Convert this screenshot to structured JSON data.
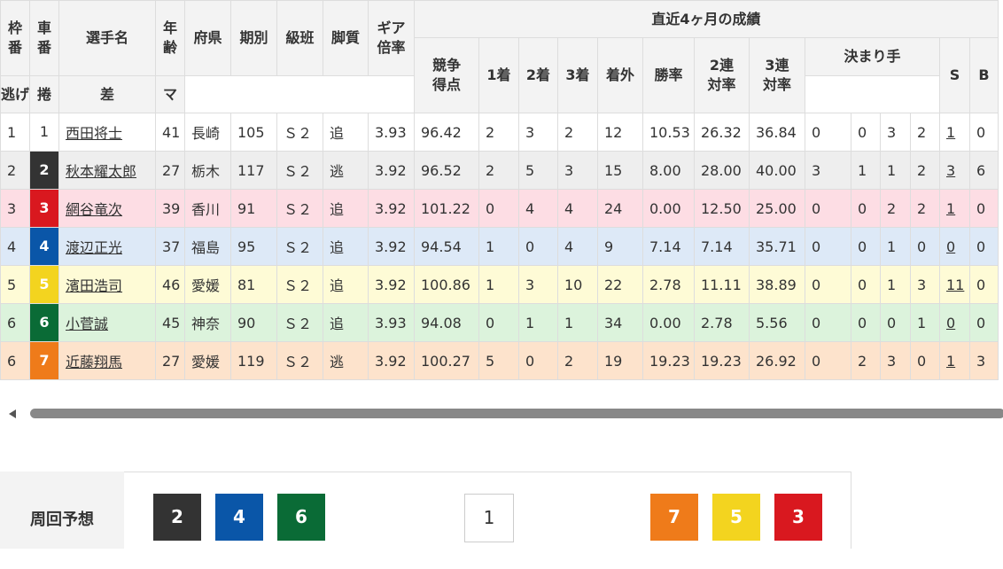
{
  "headers": {
    "waku": "枠\n番",
    "car": "車\n番",
    "name": "選手名",
    "age": "年\n齢",
    "pref": "府県",
    "term": "期別",
    "class": "級班",
    "leg": "脚質",
    "gear": "ギア\n倍率",
    "recent": "直近4ヶ月の成績",
    "score": "競争\n得点",
    "p1": "1着",
    "p2": "2着",
    "p3": "3着",
    "out": "着外",
    "win": "勝率",
    "r2": "2連\n対率",
    "r3": "3連\n対率",
    "kimarite": "決まり手",
    "nige": "逃げ",
    "makuri": "捲",
    "sashi": "差",
    "ma": "マ",
    "s": "S",
    "b": "B"
  },
  "rows": [
    {
      "waku": "1",
      "car": "1",
      "name": "西田将士",
      "age": "41",
      "pref": "長崎",
      "term": "105",
      "cls": "Ｓ２",
      "leg": "追",
      "gear": "3.93",
      "score": "96.42",
      "p1": "2",
      "p2": "3",
      "p3": "2",
      "out": "12",
      "win": "10.53",
      "r2": "26.32",
      "r3": "36.84",
      "nige": "0",
      "makuri": "0",
      "sashi": "3",
      "ma": "2",
      "s": "1",
      "b": "0"
    },
    {
      "waku": "2",
      "car": "2",
      "name": "秋本耀太郎",
      "age": "27",
      "pref": "栃木",
      "term": "117",
      "cls": "Ｓ２",
      "leg": "逃",
      "gear": "3.92",
      "score": "96.52",
      "p1": "2",
      "p2": "5",
      "p3": "3",
      "out": "15",
      "win": "8.00",
      "r2": "28.00",
      "r3": "40.00",
      "nige": "3",
      "makuri": "1",
      "sashi": "1",
      "ma": "2",
      "s": "3",
      "b": "6"
    },
    {
      "waku": "3",
      "car": "3",
      "name": "網谷竜次",
      "age": "39",
      "pref": "香川",
      "term": "91",
      "cls": "Ｓ２",
      "leg": "追",
      "gear": "3.92",
      "score": "101.22",
      "p1": "0",
      "p2": "4",
      "p3": "4",
      "out": "24",
      "win": "0.00",
      "r2": "12.50",
      "r3": "25.00",
      "nige": "0",
      "makuri": "0",
      "sashi": "2",
      "ma": "2",
      "s": "1",
      "b": "0"
    },
    {
      "waku": "4",
      "car": "4",
      "name": "渡辺正光",
      "age": "37",
      "pref": "福島",
      "term": "95",
      "cls": "Ｓ２",
      "leg": "追",
      "gear": "3.92",
      "score": "94.54",
      "p1": "1",
      "p2": "0",
      "p3": "4",
      "out": "9",
      "win": "7.14",
      "r2": "7.14",
      "r3": "35.71",
      "nige": "0",
      "makuri": "0",
      "sashi": "1",
      "ma": "0",
      "s": "0",
      "b": "0"
    },
    {
      "waku": "5",
      "car": "5",
      "name": "濱田浩司",
      "age": "46",
      "pref": "愛媛",
      "term": "81",
      "cls": "Ｓ２",
      "leg": "追",
      "gear": "3.92",
      "score": "100.86",
      "p1": "1",
      "p2": "3",
      "p3": "10",
      "out": "22",
      "win": "2.78",
      "r2": "11.11",
      "r3": "38.89",
      "nige": "0",
      "makuri": "0",
      "sashi": "1",
      "ma": "3",
      "s": "11",
      "b": "0"
    },
    {
      "waku": "6",
      "car": "6",
      "name": "小菅誠",
      "age": "45",
      "pref": "神奈",
      "term": "90",
      "cls": "Ｓ２",
      "leg": "追",
      "gear": "3.93",
      "score": "94.08",
      "p1": "0",
      "p2": "1",
      "p3": "1",
      "out": "34",
      "win": "0.00",
      "r2": "2.78",
      "r3": "5.56",
      "nige": "0",
      "makuri": "0",
      "sashi": "0",
      "ma": "1",
      "s": "0",
      "b": "0"
    },
    {
      "waku": "6",
      "car": "7",
      "name": "近藤翔馬",
      "age": "27",
      "pref": "愛媛",
      "term": "119",
      "cls": "Ｓ２",
      "leg": "逃",
      "gear": "3.92",
      "score": "100.27",
      "p1": "5",
      "p2": "0",
      "p3": "2",
      "out": "19",
      "win": "19.23",
      "r2": "19.23",
      "r3": "26.92",
      "nige": "0",
      "makuri": "2",
      "sashi": "3",
      "ma": "0",
      "s": "1",
      "b": "3"
    }
  ],
  "car_colors": {
    "1": {
      "bg": "#ffffff",
      "fg": "#333333"
    },
    "2": {
      "bg": "#333333",
      "fg": "#ffffff"
    },
    "3": {
      "bg": "#d9181f",
      "fg": "#ffffff"
    },
    "4": {
      "bg": "#0a56a8",
      "fg": "#ffffff"
    },
    "5": {
      "bg": "#f3d41f",
      "fg": "#ffffff"
    },
    "6": {
      "bg": "#0a6b36",
      "fg": "#ffffff"
    },
    "7": {
      "bg": "#ef7b1a",
      "fg": "#ffffff"
    }
  },
  "prediction": {
    "label": "周回予想",
    "groups": [
      [
        "2",
        "4",
        "6"
      ],
      [
        "1"
      ],
      [
        "7",
        "5",
        "3"
      ]
    ]
  },
  "scrollbar": {
    "left_arrow_icon": "triangle-left-icon"
  }
}
